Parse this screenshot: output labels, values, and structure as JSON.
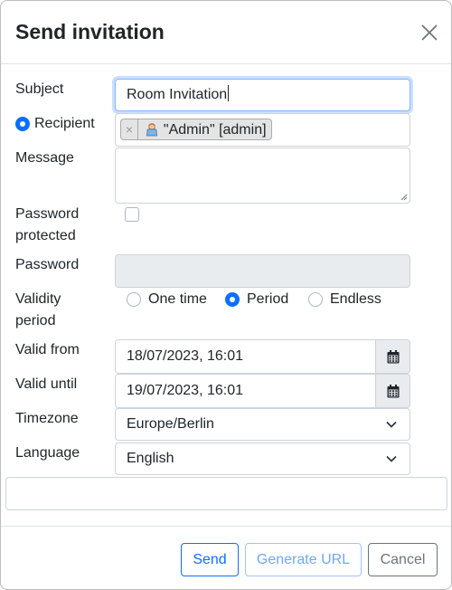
{
  "dialog": {
    "title": "Send invitation",
    "close_icon": "close-icon"
  },
  "form": {
    "subject": {
      "label": "Subject",
      "value": "Room Invitation"
    },
    "recipient": {
      "label": "Recipient",
      "selected": true,
      "tags": [
        {
          "text": "\"Admin\" [admin]",
          "remove_glyph": "×",
          "icon": "user-avatar-icon"
        }
      ]
    },
    "message": {
      "label": "Message",
      "value": ""
    },
    "password_protected": {
      "label_line1": "Password",
      "label_line2": "protected",
      "checked": false
    },
    "password": {
      "label": "Password",
      "value": "",
      "disabled": true
    },
    "validity": {
      "label_line1": "Validity",
      "label_line2": "period",
      "options": [
        "One time",
        "Period",
        "Endless"
      ],
      "selected": "Period"
    },
    "valid_from": {
      "label": "Valid from",
      "value": "18/07/2023, 16:01",
      "icon": "calendar-icon"
    },
    "valid_until": {
      "label": "Valid until",
      "value": "19/07/2023, 16:01",
      "icon": "calendar-icon"
    },
    "timezone": {
      "label": "Timezone",
      "value": "Europe/Berlin"
    },
    "language": {
      "label": "Language",
      "value": "English"
    }
  },
  "footer": {
    "send_label": "Send",
    "generate_url_label": "Generate URL",
    "cancel_label": "Cancel"
  },
  "colors": {
    "primary": "#0d6efd",
    "primary_light": "#6ea8fe",
    "secondary": "#6c757d",
    "border": "#ced4da",
    "disabled_bg": "#e9ecef"
  }
}
